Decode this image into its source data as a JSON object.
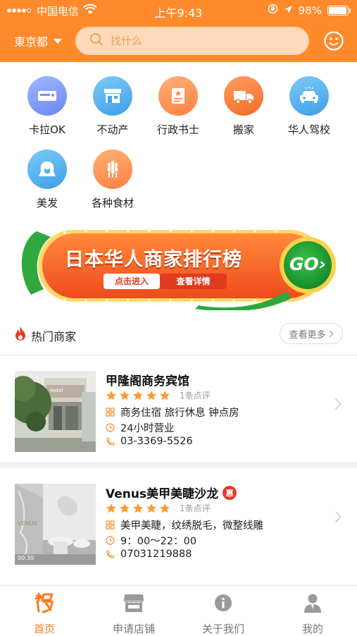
{
  "status_bar": {
    "carrier": "中国电信",
    "time": "上午9:43",
    "battery": "98%",
    "battery_level": 0.98
  },
  "header": {
    "city": "東京都",
    "search_placeholder": "找什么"
  },
  "categories": [
    {
      "label": "卡拉OK",
      "icon": "karaoke-icon"
    },
    {
      "label": "不动产",
      "icon": "store-icon"
    },
    {
      "label": "行政书士",
      "icon": "certificate-icon"
    },
    {
      "label": "搬家",
      "icon": "truck-icon"
    },
    {
      "label": "华人驾校",
      "icon": "car-icon"
    },
    {
      "label": "美发",
      "icon": "hair-icon"
    },
    {
      "label": "各种食材",
      "icon": "wheat-icon"
    }
  ],
  "banner": {
    "title": "日本华人商家排行榜",
    "enter": "点击进入",
    "details": "查看详情",
    "go": "GO›"
  },
  "hot": {
    "title": "热门商家",
    "more": "查看更多"
  },
  "stores": [
    {
      "name": "甲隆阁商务宾馆",
      "rating": 5,
      "reviews": "1条点评",
      "tags": "商务住宿 旅行休息 钟点房",
      "hours": "24小时营业",
      "phone": "03-3369-5526",
      "photo_sign": "Hotel"
    },
    {
      "name": "Venus美甲美睫沙龙",
      "badge": "惠",
      "rating": 5,
      "reviews": "1条点评",
      "tags": "美甲美睫，纹绣脱毛，微整线雕",
      "hours": "9：00～22：00",
      "phone": "07031219888",
      "photo_sign": "VENUS",
      "photo_time": "00:30"
    }
  ],
  "tabs": [
    {
      "label": "首页",
      "icon": "home-icon",
      "active": true
    },
    {
      "label": "申请店铺",
      "icon": "shop-icon"
    },
    {
      "label": "关于我们",
      "icon": "info-icon"
    },
    {
      "label": "我的",
      "icon": "profile-icon"
    }
  ],
  "colors": {
    "brand": "#ff8a2b",
    "active_tab": "#ff7a1f",
    "star": "#ff9a2e",
    "badge": "#e8382d"
  }
}
